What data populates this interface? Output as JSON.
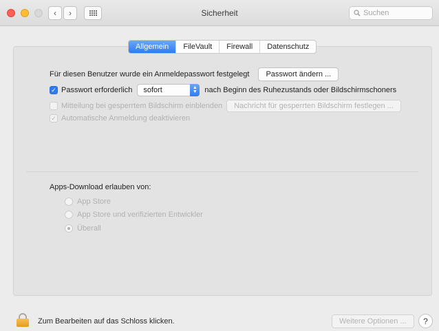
{
  "window": {
    "title": "Sicherheit"
  },
  "toolbar": {
    "back_icon": "chevron-left-icon",
    "forward_icon": "chevron-right-icon",
    "grid_icon": "show-all-grid-icon",
    "search_placeholder": "Suchen"
  },
  "tabs": [
    {
      "label": "Allgemein",
      "active": true
    },
    {
      "label": "FileVault",
      "active": false
    },
    {
      "label": "Firewall",
      "active": false
    },
    {
      "label": "Datenschutz",
      "active": false
    }
  ],
  "general": {
    "login_password_text": "Für diesen Benutzer wurde ein Anmeldepasswort festgelegt",
    "change_password_button": "Passwort ändern ...",
    "require_password_label": "Passwort erforderlich",
    "require_password_checked": true,
    "require_password_select_value": "sofort",
    "require_password_suffix": "nach Beginn des Ruhezustands oder Bildschirmschoners",
    "show_message_label": "Mitteilung bei gesperrtem Bildschirm einblenden",
    "show_message_checked": false,
    "set_message_button": "Nachricht für gesperrten Bildschirm festlegen ...",
    "disable_autologin_label": "Automatische Anmeldung deaktivieren",
    "disable_autologin_checked": true
  },
  "downloads": {
    "heading": "Apps-Download erlauben von:",
    "options": [
      {
        "label": "App Store",
        "selected": false
      },
      {
        "label": "App Store und verifizierten Entwickler",
        "selected": false
      },
      {
        "label": "Überall",
        "selected": true
      }
    ]
  },
  "footer": {
    "lock_text": "Zum Bearbeiten auf das Schloss klicken.",
    "advanced_button": "Weitere Optionen ...",
    "help_label": "?"
  },
  "colors": {
    "accent": "#2d7cf5",
    "lock": "#f0a52a"
  }
}
